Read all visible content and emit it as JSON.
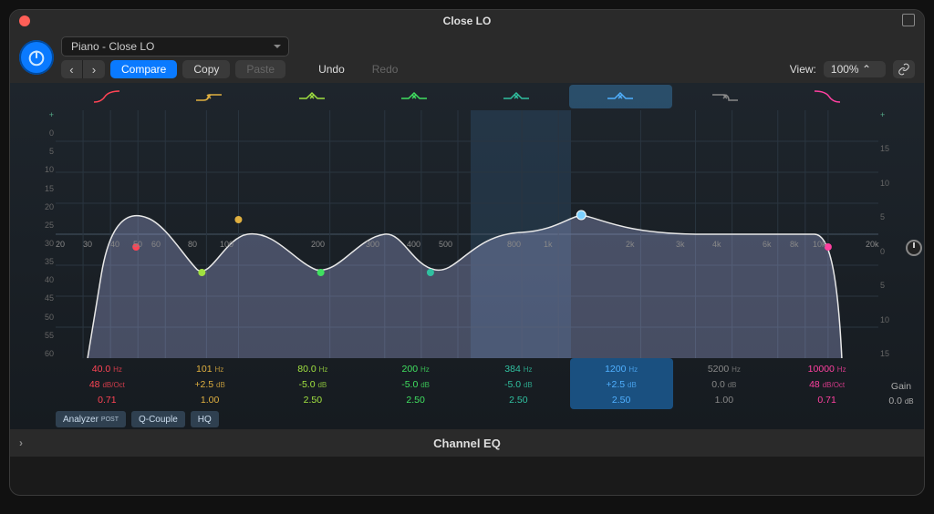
{
  "window_title": "Close LO",
  "preset_name": "Piano - Close LO",
  "toolbar": {
    "compare": "Compare",
    "copy": "Copy",
    "paste": "Paste",
    "undo": "Undo",
    "redo": "Redo",
    "view_label": "View:",
    "zoom": "100%"
  },
  "left_scale": [
    "+",
    "0",
    "5",
    "10",
    "15",
    "20",
    "25",
    "30",
    "35",
    "40",
    "45",
    "50",
    "55",
    "60"
  ],
  "right_scale": [
    "+",
    "15",
    "10",
    "5",
    "0",
    "5",
    "10",
    "15"
  ],
  "freq_ticks": [
    "20",
    "30",
    "40",
    "50",
    "60",
    "80",
    "100",
    "200",
    "300",
    "400",
    "500",
    "800",
    "1k",
    "2k",
    "3k",
    "4k",
    "6k",
    "8k",
    "10k",
    "20k"
  ],
  "bands": [
    {
      "color": "#ff4455",
      "freq": "40.0",
      "funit": "Hz",
      "p2": "48",
      "p2unit": "dB/Oct",
      "p3": "0.71",
      "selected": false,
      "type": "hpf"
    },
    {
      "color": "#e0b040",
      "freq": "101",
      "funit": "Hz",
      "p2": "+2.5",
      "p2unit": "dB",
      "p3": "1.00",
      "selected": false,
      "type": "shelf-low"
    },
    {
      "color": "#a0e040",
      "freq": "80.0",
      "funit": "Hz",
      "p2": "-5.0",
      "p2unit": "dB",
      "p3": "2.50",
      "selected": false,
      "type": "bell"
    },
    {
      "color": "#40e060",
      "freq": "200",
      "funit": "Hz",
      "p2": "-5.0",
      "p2unit": "dB",
      "p3": "2.50",
      "selected": false,
      "type": "bell"
    },
    {
      "color": "#30c0a0",
      "freq": "384",
      "funit": "Hz",
      "p2": "-5.0",
      "p2unit": "dB",
      "p3": "2.50",
      "selected": false,
      "type": "bell"
    },
    {
      "color": "#50b0ff",
      "freq": "1200",
      "funit": "Hz",
      "p2": "+2.5",
      "p2unit": "dB",
      "p3": "2.50",
      "selected": true,
      "type": "bell"
    },
    {
      "color": "#888888",
      "freq": "5200",
      "funit": "Hz",
      "p2": "0.0",
      "p2unit": "dB",
      "p3": "1.00",
      "selected": false,
      "type": "shelf-high"
    },
    {
      "color": "#ff40a0",
      "freq": "10000",
      "funit": "Hz",
      "p2": "48",
      "p2unit": "dB/Oct",
      "p3": "0.71",
      "selected": false,
      "type": "lpf"
    }
  ],
  "gain": {
    "label": "Gain",
    "value": "0.0",
    "unit": "dB"
  },
  "footer_buttons": {
    "analyzer": "Analyzer",
    "analyzer_mode": "POST",
    "qcouple": "Q-Couple",
    "hq": "HQ"
  },
  "plugin_name": "Channel EQ"
}
